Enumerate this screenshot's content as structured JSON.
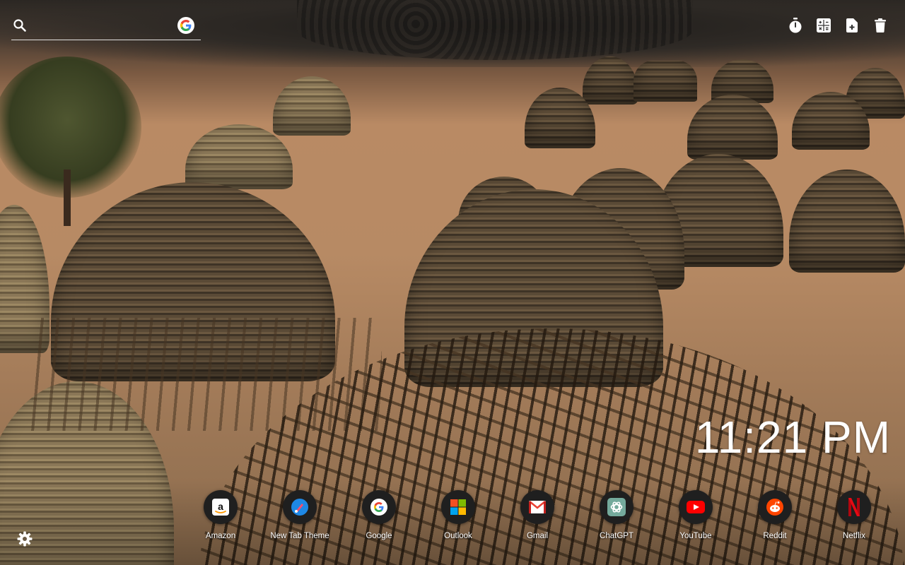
{
  "search": {
    "placeholder": "",
    "icon": "search-icon",
    "engine_icon": "google-g-icon"
  },
  "top_tools": [
    {
      "icon": "timer-icon"
    },
    {
      "icon": "calculator-icon"
    },
    {
      "icon": "add-note-icon"
    },
    {
      "icon": "trash-icon"
    }
  ],
  "clock": {
    "time": "11:21 PM"
  },
  "shortcuts": [
    {
      "label": "Amazon",
      "icon": "amazon-icon",
      "color": "#ffffff"
    },
    {
      "label": "New Tab Theme",
      "icon": "new-tab-theme-icon",
      "color": "#1e88e5"
    },
    {
      "label": "Google",
      "icon": "google-icon",
      "color": "#ffffff"
    },
    {
      "label": "Outlook",
      "icon": "microsoft-icon",
      "color": "#f25022"
    },
    {
      "label": "Gmail",
      "icon": "gmail-icon",
      "color": "#ea4335"
    },
    {
      "label": "ChatGPT",
      "icon": "chatgpt-icon",
      "color": "#74aa9c"
    },
    {
      "label": "YouTube",
      "icon": "youtube-icon",
      "color": "#ff0000"
    },
    {
      "label": "Reddit",
      "icon": "reddit-icon",
      "color": "#ff4500"
    },
    {
      "label": "Netflix",
      "icon": "netflix-icon",
      "color": "#e50914"
    }
  ],
  "settings": {
    "icon": "gear-icon"
  }
}
